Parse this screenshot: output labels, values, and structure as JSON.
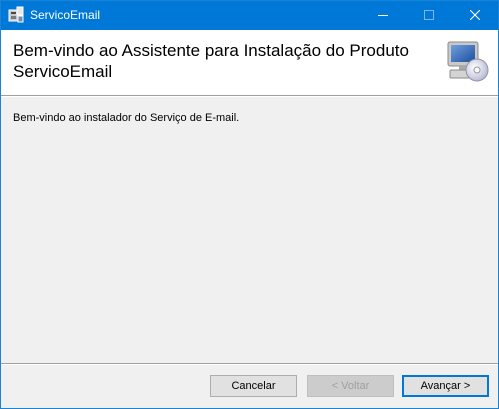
{
  "window": {
    "title": "ServicoEmail",
    "icon": "installer-package-icon",
    "controls": {
      "minimize_icon": "minimize-icon",
      "maximize_icon": "maximize-icon",
      "close_icon": "close-icon"
    }
  },
  "banner": {
    "title": "Bem-vindo ao Assistente para Instalação do Produto ServicoEmail",
    "icon": "computer-cd-icon"
  },
  "body": {
    "welcome_text": "Bem-vindo ao instalador do Serviço de E-mail."
  },
  "buttons": {
    "cancel_label": "Cancelar",
    "back_label": "< Voltar",
    "next_label": "Avançar >"
  },
  "colors": {
    "titlebar": "#0078d7",
    "dialog_background": "#f0f0f0",
    "banner_background": "#ffffff",
    "default_button_border": "#0078d7"
  }
}
